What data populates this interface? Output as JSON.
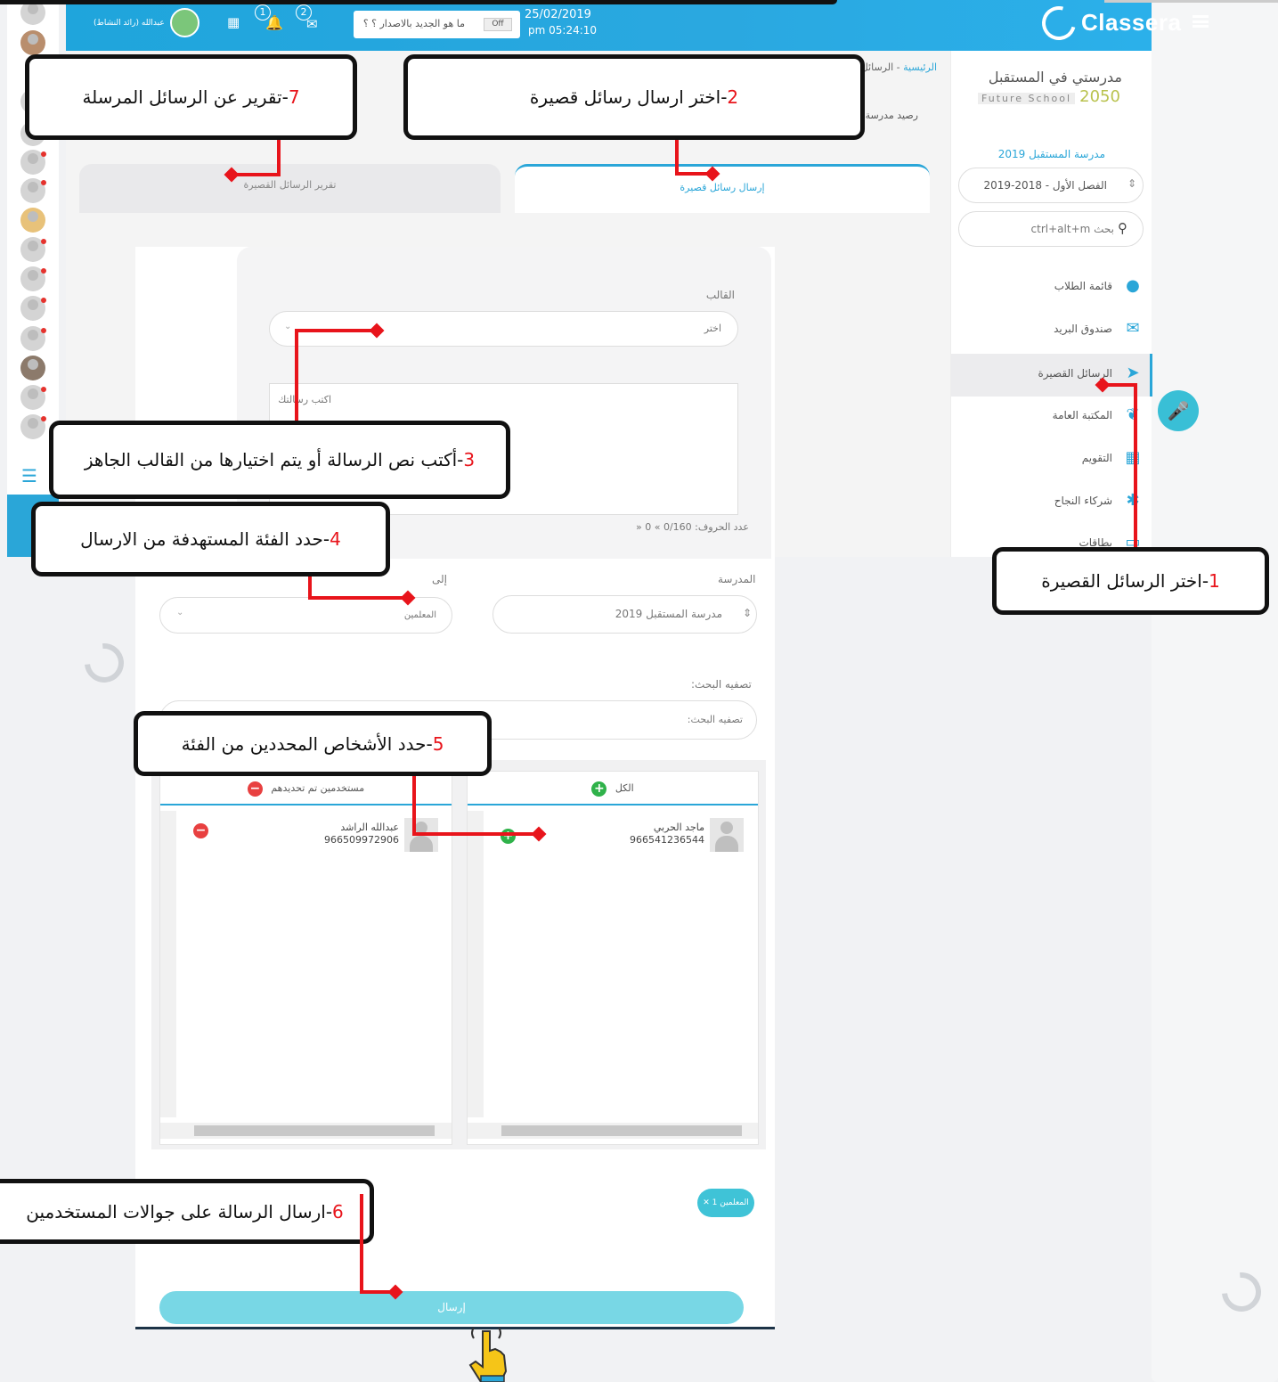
{
  "header": {
    "brand": "Classera",
    "user_name": "عبدالله (رائد النشاط)",
    "whats_new": "ما هو الجديد بالاصدار ؟ ؟",
    "toggle": "Off",
    "date": "25/02/2019",
    "time": "05:24:10 pm",
    "notif_count": "1",
    "msg_count": "2"
  },
  "school": {
    "name_line1": "مدرستي في المستقبل",
    "name_line2": "Future School",
    "year": "2050",
    "school_title": "مدرسة المستقبل 2019",
    "semester": "الفصل الأول - 2018-2019",
    "search_placeholder": "بحث ctrl+alt+m"
  },
  "sidebar": {
    "items": [
      {
        "label": "قائمة الطلاب",
        "icon": "user-icon"
      },
      {
        "label": "صندوق البريد",
        "icon": "mail-icon"
      },
      {
        "label": "الرسائل القصيرة",
        "icon": "send-icon"
      },
      {
        "label": "المكتبة العامة",
        "icon": "leaf-icon"
      },
      {
        "label": "التقويم",
        "icon": "calendar-icon"
      },
      {
        "label": "شركاء النجاح",
        "icon": "partners-icon"
      },
      {
        "label": "بطاقات",
        "icon": "card-icon"
      }
    ]
  },
  "breadcrumb": {
    "home": "الرئيسية",
    "separator": " - ",
    "current": "الرسائل"
  },
  "balance_label": "رصيد مدرسة",
  "tabs": {
    "send": "إرسال رسائل قصيرة",
    "report": "تقرير الرسائل القصيرة"
  },
  "form": {
    "template_label": "القالب",
    "template_placeholder": "اختر",
    "message_placeholder": "اكتب رسالتك",
    "char_count": "عدد الحروف: 0/160 » 0 «",
    "school_label": "المدرسة",
    "school_value": "مدرسة المستقبل 2019",
    "to_label": "إلى",
    "to_value": "المعلمين",
    "filter_label": "تصفيه البحث:",
    "filter_placeholder": "تصفيه البحث:",
    "all_label": "الكل",
    "selected_label": "مستخدمين تم تحديدهم",
    "available_user": {
      "name": "ماجد الحربي",
      "phone": "966541236544"
    },
    "selected_user": {
      "name": "عبدالله الراشد",
      "phone": "966509972906"
    },
    "tag_chip": "المعلمين 1 ✕",
    "send_label": "إرسال"
  },
  "callouts": {
    "c1": {
      "num": "1",
      "text": "-اختر الرسائل القصيرة"
    },
    "c2": {
      "num": "2",
      "text": "-اختر ارسال رسائل قصيرة"
    },
    "c3": {
      "num": "3",
      "text": "-أكتب نص الرسالة أو يتم اختيارها من القالب الجاهز"
    },
    "c4": {
      "num": "4",
      "text": "-حدد الفئة المستهدفة من  الارسال"
    },
    "c5": {
      "num": "5",
      "text": "-حدد الأشخاص المحددين من الفئة"
    },
    "c6": {
      "num": "6",
      "text": "-ارسال الرسالة على جوالات المستخدمين"
    },
    "c7": {
      "num": "7",
      "text": "-تقرير عن الرسائل المرسلة"
    }
  },
  "colors": {
    "accent": "#2aa6d8",
    "annotation_red": "#e8141b",
    "send_button": "#78d7e5"
  }
}
